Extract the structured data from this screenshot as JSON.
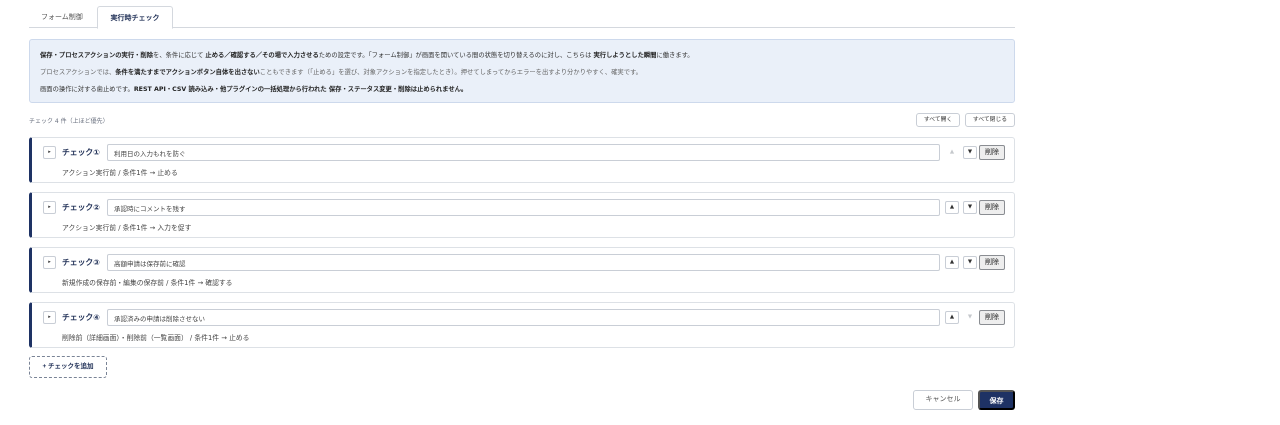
{
  "tabs": [
    {
      "label": "フォーム制御",
      "active": false
    },
    {
      "label": "実行時チェック",
      "active": true
    }
  ],
  "info": {
    "l1": [
      {
        "t": "保存・プロセスアクションの実行・削除",
        "b": true
      },
      {
        "t": "を、条件に応じて ",
        "b": false
      },
      {
        "t": "止める／確認する／その場で入力させる",
        "b": true
      },
      {
        "t": "ための設定です。「フォーム制御」が画面を開いている間の状態を切り替えるのに対し、こちらは ",
        "b": false
      },
      {
        "t": "実行しようとした瞬間",
        "b": true
      },
      {
        "t": "に働きます。",
        "b": false
      }
    ],
    "l2": [
      {
        "t": "プロセスアクションでは、",
        "b": false
      },
      {
        "t": "条件を満たすまでアクションボタン自体を出さない",
        "b": true
      },
      {
        "t": "こともできます（「止める」を選び、対象アクションを指定したとき）。押せてしまってからエラーを出すより分かりやすく、確実です。",
        "b": false
      }
    ],
    "l3": [
      {
        "t": "画面の操作に対する歯止めです。",
        "b": false
      },
      {
        "t": "REST API・CSV 読み込み・他プラグインの一括処理から行われた 保存・ステータス変更・削除は止められません。",
        "b": true
      }
    ]
  },
  "list": {
    "count_label": "チェック 4 件（上ほど優先）",
    "expand_all": "すべて開く",
    "collapse_all": "すべて閉じる"
  },
  "icons": {
    "toggle": "▸",
    "up": "▲",
    "down": "▼"
  },
  "checks": [
    {
      "title": "チェック①",
      "name": "利用日の入力もれを防ぐ",
      "summary": "アクション実行前 / 条件1件 → 止める",
      "up_enabled": false,
      "down_enabled": true,
      "delete_label": "削除"
    },
    {
      "title": "チェック②",
      "name": "承認時にコメントを残す",
      "summary": "アクション実行前 / 条件1件 → 入力を促す",
      "up_enabled": true,
      "down_enabled": true,
      "delete_label": "削除"
    },
    {
      "title": "チェック③",
      "name": "高額申請は保存前に確認",
      "summary": "新規作成の保存前・編集の保存前 / 条件1件 → 確認する",
      "up_enabled": true,
      "down_enabled": true,
      "delete_label": "削除"
    },
    {
      "title": "チェック④",
      "name": "承認済みの申請は削除させない",
      "summary": "削除前（詳細画面）・削除前（一覧画面） / 条件1件 → 止める",
      "up_enabled": true,
      "down_enabled": false,
      "delete_label": "削除"
    }
  ],
  "add_button": "+ チェックを追加",
  "footer": {
    "cancel": "キャンセル",
    "save": "保存"
  },
  "colors": {
    "primary": "#1e3264",
    "info_bg": "#eaf0f9"
  }
}
